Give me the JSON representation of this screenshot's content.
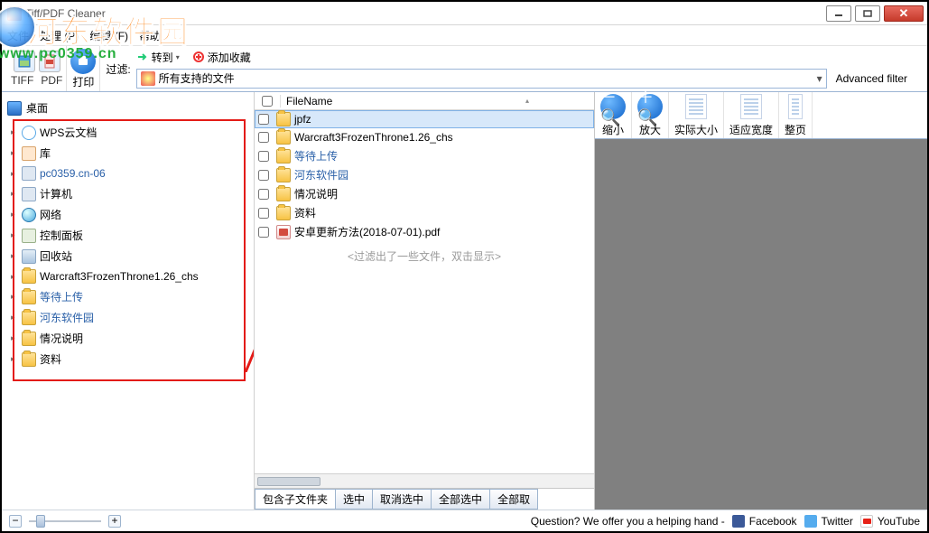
{
  "window": {
    "title": "Tiff/PDF Cleaner"
  },
  "watermark": {
    "line1": "河东软件园",
    "line2": "www.pc0359.cn"
  },
  "menu": {
    "file": "文件",
    "process": "处理 (P)",
    "edit": "编辑 (F)",
    "help": "帮助"
  },
  "toolbar": {
    "tiff": "TIFF",
    "pdf": "PDF",
    "print": "打印",
    "filter_label": "过滤:",
    "convert": "转到",
    "fav": "添加收藏",
    "filter_value": "所有支持的文件",
    "advanced": "Advanced filter"
  },
  "tree": {
    "root": "桌面",
    "items": [
      {
        "label": "WPS云文档",
        "icon": "ic-cloud"
      },
      {
        "label": "库",
        "icon": "ic-lib"
      },
      {
        "label": "pc0359.cn-06",
        "icon": "ic-pc",
        "blue": true
      },
      {
        "label": "计算机",
        "icon": "ic-pc"
      },
      {
        "label": "网络",
        "icon": "ic-net"
      },
      {
        "label": "控制面板",
        "icon": "ic-cp"
      },
      {
        "label": "回收站",
        "icon": "ic-bin"
      },
      {
        "label": "Warcraft3FrozenThrone1.26_chs",
        "icon": "ic-folder"
      },
      {
        "label": "等待上传",
        "icon": "ic-folder",
        "blue": true
      },
      {
        "label": "河东软件园",
        "icon": "ic-folder",
        "blue": true
      },
      {
        "label": "情况说明",
        "icon": "ic-folder"
      },
      {
        "label": "资料",
        "icon": "ic-folder"
      }
    ]
  },
  "filelist": {
    "header": "FileName",
    "rows": [
      {
        "name": "jpfz",
        "icon": "ic-folder",
        "selected": true
      },
      {
        "name": "Warcraft3FrozenThrone1.26_chs",
        "icon": "ic-folder"
      },
      {
        "name": "等待上传",
        "icon": "ic-folder",
        "blue": true
      },
      {
        "name": "河东软件园",
        "icon": "ic-folder",
        "blue": true
      },
      {
        "name": "情况说明",
        "icon": "ic-folder"
      },
      {
        "name": "资料",
        "icon": "ic-folder"
      },
      {
        "name": "安卓更新方法(2018-07-01).pdf",
        "icon": "ic-pdf"
      }
    ],
    "filter_note": "<过滤出了一些文件，双击显示>",
    "buttons": {
      "b1": "包含子文件夹",
      "b2": "选中",
      "b3": "取消选中",
      "b4": "全部选中",
      "b5": "全部取"
    }
  },
  "preview": {
    "zoom_out": "缩小",
    "zoom_in": "放大",
    "actual": "实际大小",
    "fit_width": "适应宽度",
    "full_page": "整页"
  },
  "status": {
    "question": "Question? We offer you a helping hand  -",
    "fb": "Facebook",
    "tw": "Twitter",
    "yt": "YouTube"
  }
}
